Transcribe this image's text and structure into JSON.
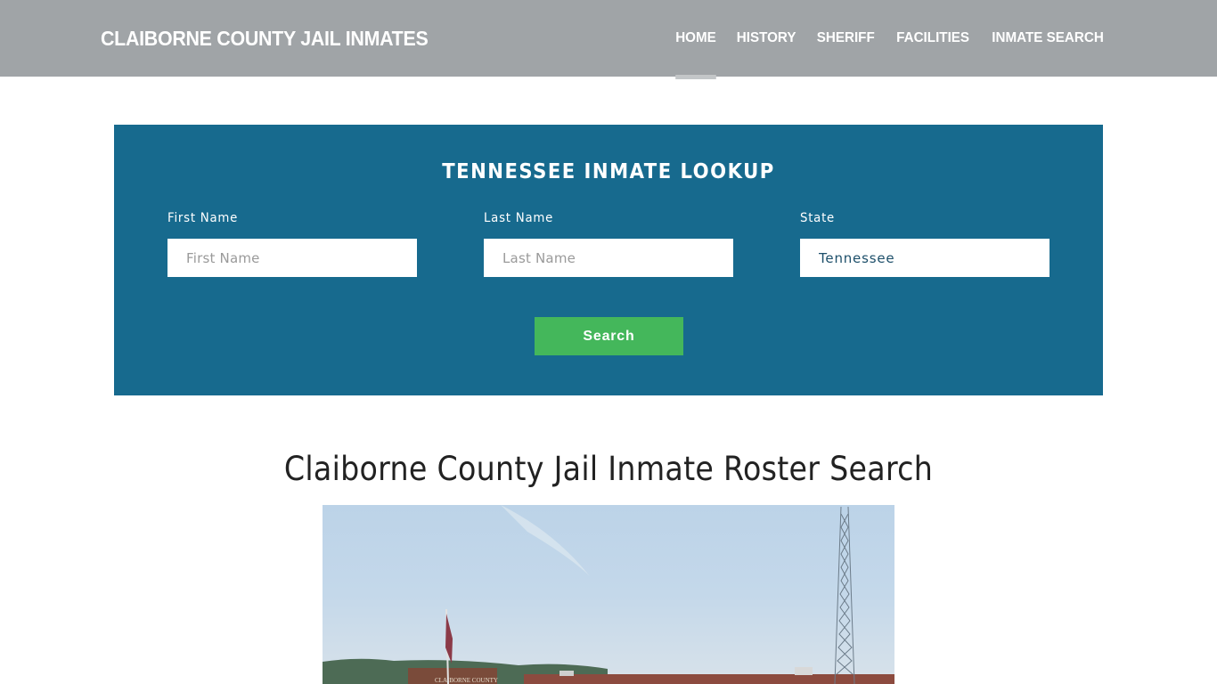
{
  "header": {
    "brand": "CLAIBORNE COUNTY JAIL INMATES",
    "nav": [
      {
        "label": "HOME",
        "active": true
      },
      {
        "label": "HISTORY",
        "active": false
      },
      {
        "label": "SHERIFF",
        "active": false
      },
      {
        "label": "FACILITIES",
        "active": false
      },
      {
        "label": "INMATE SEARCH",
        "active": false
      }
    ]
  },
  "lookup": {
    "title": "TENNESSEE INMATE LOOKUP",
    "first_name": {
      "label": "First Name",
      "placeholder": "First Name",
      "value": ""
    },
    "last_name": {
      "label": "Last Name",
      "placeholder": "Last Name",
      "value": ""
    },
    "state": {
      "label": "State",
      "value": "Tennessee"
    },
    "search_label": "Search",
    "colors": {
      "panel": "#176a8e",
      "button": "#44b75b"
    }
  },
  "main": {
    "heading": "Claiborne County Jail Inmate Roster Search",
    "photo": {
      "alt": "Claiborne County jail building with flag and radio tower",
      "sign_text": "CLAIBORNE COUNTY"
    }
  }
}
